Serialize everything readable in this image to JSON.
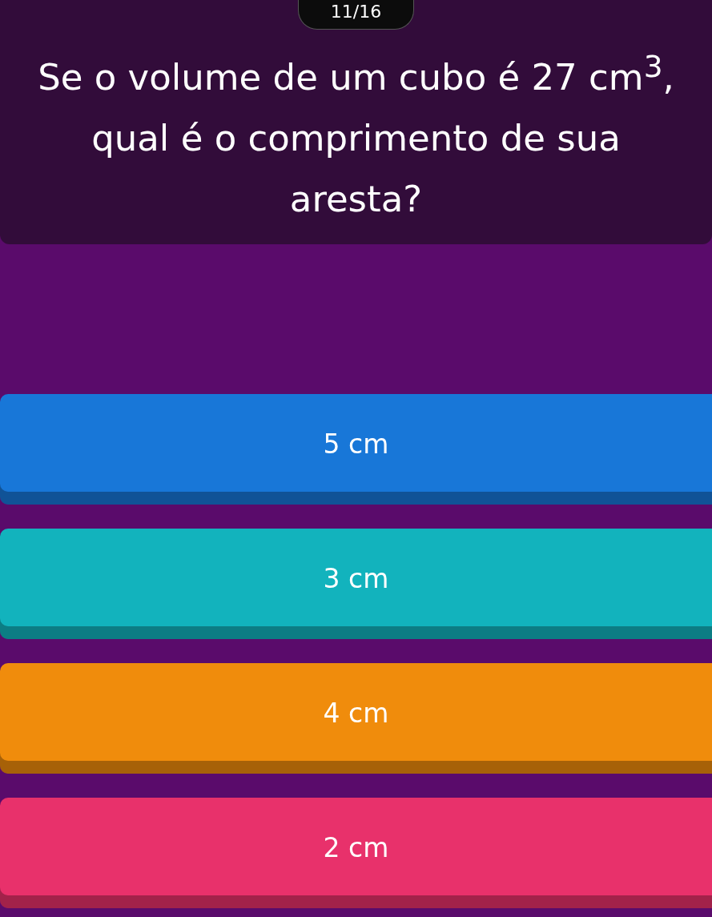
{
  "counter": "11/16",
  "question": "Se o volume de um cubo é 27 cm$^{3}$, qual é o comprimento de sua aresta?",
  "options": [
    {
      "label": "5 cm",
      "color": "#1877d8"
    },
    {
      "label": "3 cm",
      "color": "#12b3bd"
    },
    {
      "label": "4 cm",
      "color": "#f08c0c"
    },
    {
      "label": "2 cm",
      "color": "#e8316b"
    }
  ]
}
